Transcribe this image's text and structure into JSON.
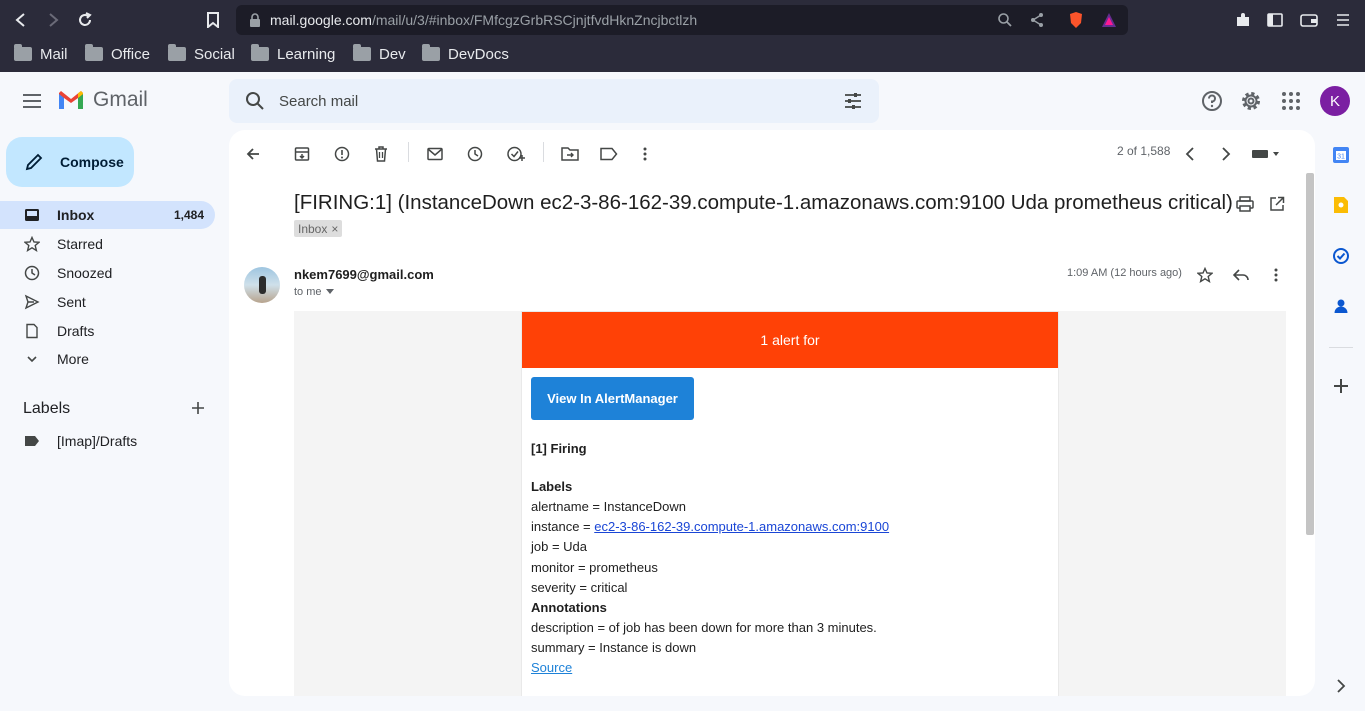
{
  "browser": {
    "url_host": "mail.google.com",
    "url_path": "/mail/u/3/#inbox/FMfcgzGrbRSCjnjtfvdHknZncjbctlzh",
    "bookmarks": [
      "Mail",
      "Office",
      "Social",
      "Learning",
      "Dev",
      "DevDocs"
    ]
  },
  "gmail": {
    "brand": "Gmail",
    "search_placeholder": "Search mail",
    "avatar_letter": "K"
  },
  "sidebar": {
    "compose_label": "Compose",
    "items": [
      {
        "label": "Inbox",
        "count": "1,484",
        "icon": "inbox-icon"
      },
      {
        "label": "Starred",
        "icon": "star-icon"
      },
      {
        "label": "Snoozed",
        "icon": "clock-icon"
      },
      {
        "label": "Sent",
        "icon": "send-icon"
      },
      {
        "label": "Drafts",
        "icon": "draft-icon"
      },
      {
        "label": "More",
        "icon": "chevron-down-icon"
      }
    ],
    "labels_title": "Labels",
    "labels": [
      "[Imap]/Drafts"
    ]
  },
  "toolbar": {
    "page_count": "2 of 1,588"
  },
  "message": {
    "subject": "[FIRING:1] (InstanceDown ec2-3-86-162-39.compute-1.amazonaws.com:9100 Uda prometheus critical)",
    "inbox_chip": "Inbox",
    "chip_close": "×",
    "sender": "nkem7699@gmail.com",
    "to": "to me",
    "time": "1:09 AM (12 hours ago)"
  },
  "alert": {
    "header": "1 alert for",
    "button": "View In AlertManager",
    "firing": "[1] Firing",
    "labels_heading": "Labels",
    "alertname": "alertname = InstanceDown",
    "instance_prefix": "instance = ",
    "instance_link": "ec2-3-86-162-39.compute-1.amazonaws.com:9100",
    "job": "job = Uda",
    "monitor": "monitor = prometheus",
    "severity": "severity = critical",
    "annotations_heading": "Annotations",
    "description": "description = of job has been down for more than 3 minutes.",
    "summary": "summary = Instance is down",
    "source": "Source"
  },
  "colors": {
    "alert_header": "#ff4106",
    "alert_button": "#1e82d8",
    "compose_bg": "#c2e7ff",
    "inbox_active": "#d3e3fd"
  }
}
